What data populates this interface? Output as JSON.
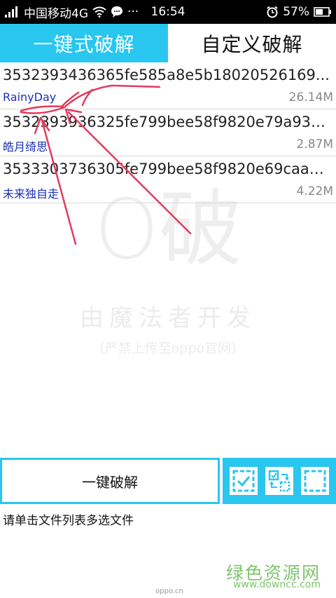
{
  "status_bar": {
    "carrier": "中国移动4G",
    "time": "16:54",
    "battery": "57%",
    "more": "···"
  },
  "tabs": [
    {
      "label": "一键式破解",
      "active": true
    },
    {
      "label": "自定义破解",
      "active": false
    }
  ],
  "files": [
    {
      "name": "3532393436365fe585a8e5b18020526169...",
      "author": "RainyDay",
      "size": "26.14M"
    },
    {
      "name": "3532393936325fe799bee58f9820e79a93e...",
      "author": "皓月绮思",
      "size": "2.87M"
    },
    {
      "name": "3533303736305fe799bee58f9820e69caae...",
      "author": "未来独自走",
      "size": "4.22M"
    }
  ],
  "watermark": {
    "big": "O破",
    "line1": "由魔法者开发",
    "line2": "(严禁上传至oppo官网)"
  },
  "actions": {
    "crack_label": "一键破解",
    "tools": [
      "select-all-icon",
      "invert-selection-icon",
      "clear-selection-icon"
    ]
  },
  "hint": "请单击文件列表多选文件",
  "site": {
    "logo": "绿色资源网",
    "url": "www.downcc.com",
    "tiny": "oppo.cn"
  },
  "colors": {
    "accent": "#29c6ef",
    "author_text": "#1a2fb8",
    "annotation": "#e23b5e",
    "site_green": "#7ec46a"
  }
}
